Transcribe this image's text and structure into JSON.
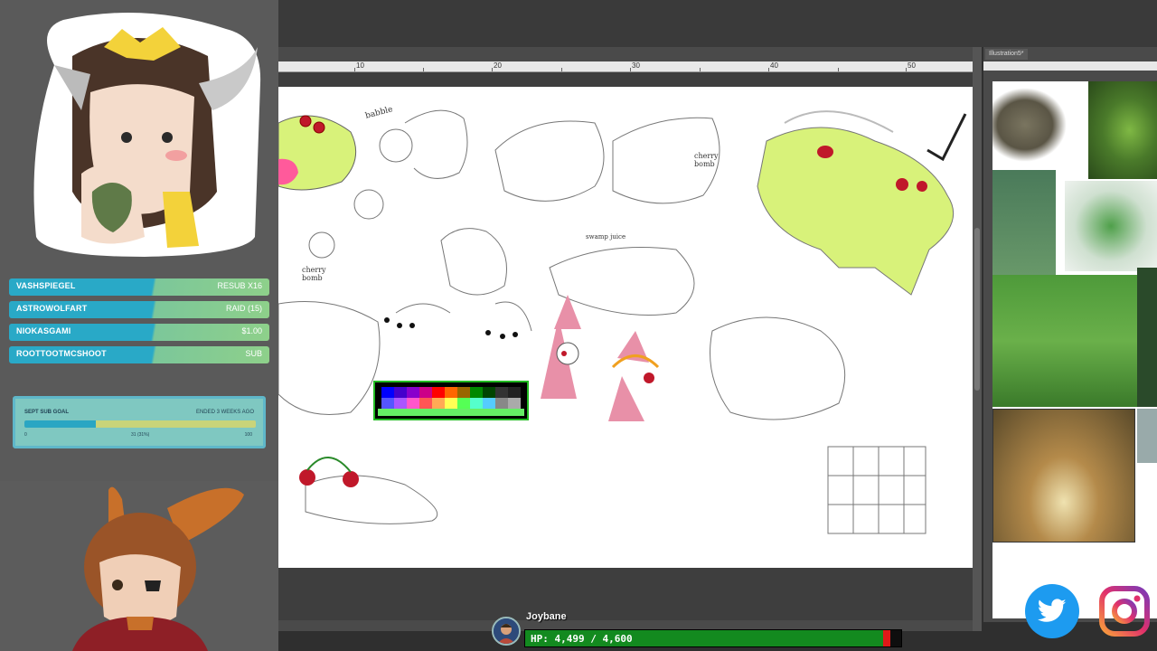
{
  "supporters": [
    {
      "name": "VASHSPIEGEL",
      "event": "RESUB X16"
    },
    {
      "name": "ASTROWOLFART",
      "event": "RAID (15)"
    },
    {
      "name": "NIOKASGAMI",
      "event": "$1.00"
    },
    {
      "name": "ROOTTOOTMCSHOOT",
      "event": "SUB"
    }
  ],
  "sub_goal": {
    "title": "SEPT SUB GOAL",
    "status": "ENDED 3 WEEKS AGO",
    "min": "0",
    "current": "31 (31%)",
    "max": "100",
    "progress": 0.31
  },
  "canvas": {
    "ruler_labels": [
      "10",
      "20",
      "30",
      "40",
      "50"
    ],
    "sketch_notes": [
      "babble",
      "cherry bomb",
      "cherry bomb",
      "swamp juice"
    ]
  },
  "reference_window": {
    "tab_title": "Illustration5*"
  },
  "hp": {
    "name": "Joybane",
    "text": "HP: 4,499 / 4,600",
    "current": 4499,
    "max": 4600
  },
  "social": {
    "icons": [
      "twitter-icon",
      "instagram-icon"
    ],
    "twitter_color": "#1d9bf0",
    "instagram_color": "#e1306c"
  },
  "colors": {
    "frog_green": "#d8f27a",
    "cherry_red": "#c0182a",
    "supporter_blue": "#29a9c7",
    "supporter_green": "#8ed08a"
  }
}
